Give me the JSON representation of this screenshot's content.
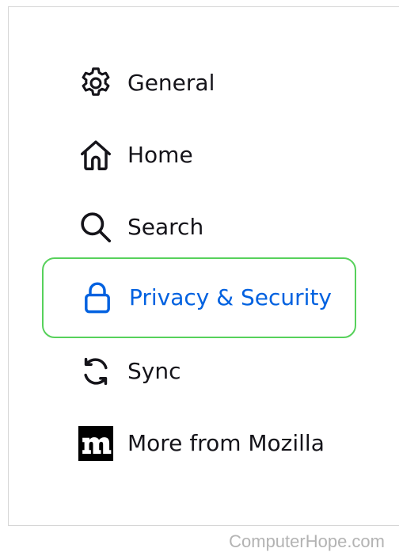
{
  "sidebar": {
    "items": [
      {
        "label": "General",
        "icon": "gear-icon"
      },
      {
        "label": "Home",
        "icon": "home-icon"
      },
      {
        "label": "Search",
        "icon": "magnifier-icon"
      },
      {
        "label": "Privacy & Security",
        "icon": "lock-icon",
        "selected": true
      },
      {
        "label": "Sync",
        "icon": "sync-icon"
      },
      {
        "label": "More from Mozilla",
        "icon": "mozilla-m-icon"
      }
    ]
  },
  "colors": {
    "text": "#15141a",
    "selected_text": "#0061e0",
    "selected_border": "#57d15b",
    "watermark": "#b3b3b3"
  },
  "watermark": "ComputerHope.com"
}
